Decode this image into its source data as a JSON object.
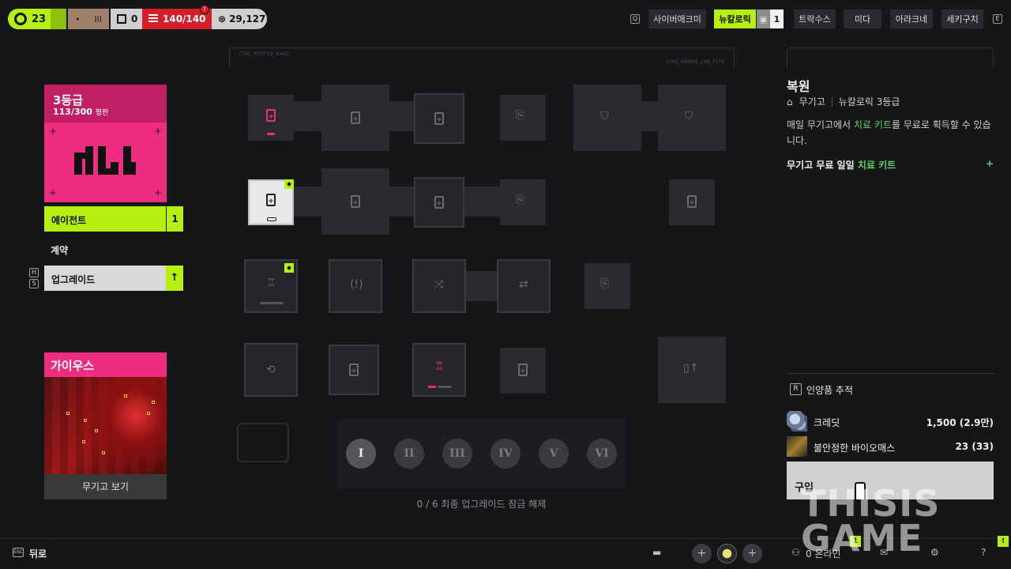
{
  "topbar": {
    "level": "23",
    "inventory_count": "0",
    "health": "140/140",
    "credits": "29,127",
    "brown_glyphs": [
      "•",
      "III"
    ],
    "key_left": "Q",
    "key_right": "E",
    "tabs": [
      {
        "label": "사이버애크미"
      },
      {
        "label": "뉴칼로릭"
      },
      {
        "label": "1"
      },
      {
        "label": "트락수스"
      },
      {
        "label": "미다"
      },
      {
        "label": "아라크네"
      },
      {
        "label": "세키구치"
      }
    ]
  },
  "left": {
    "grade_title": "3등급",
    "grade_progress": "113/300",
    "grade_rank": "평판",
    "logo_text": "NU",
    "agent_label": "에이전트",
    "agent_count": "1",
    "contract_label": "계약",
    "upgrade_label": "업그레이드",
    "upgrade_keys": [
      "H",
      "S"
    ],
    "virus_title": "가이우스",
    "virus_button": "무기고 보기"
  },
  "grid": {
    "frame_left_text": "CYAC_PROFILE_KALO",
    "frame_right_text": "CYAC_NAWEE_LAB_0178",
    "tiers": [
      "I",
      "II",
      "III",
      "IV",
      "V",
      "VI"
    ],
    "unlock_text": "0 / 6 최종 업그레이드 잠금 해제"
  },
  "right": {
    "title": "복원",
    "meta_source": "무기고",
    "meta_grade": "뉴칼로릭 3등급",
    "desc_pre": "매일 무기고에서 ",
    "desc_hl": "치료 키트",
    "desc_post": "를 무료로 획득할 수 있습니다.",
    "perk_pre": "무기고 무료 일일 ",
    "perk_hl": "치료 키트",
    "perk_plus": "+",
    "track_key": "R",
    "track_label": "인양품 추적",
    "resources": [
      {
        "name": "크레딧",
        "value": "1,500 (2.9만)"
      },
      {
        "name": "불안정한 바이오매스",
        "value": "23 (33)"
      }
    ],
    "buy_label": "구입"
  },
  "bottom": {
    "esc_key": "ESC",
    "back_label": "뒤로",
    "online_label": "0 온라인",
    "notif_a": "1",
    "notif_b": "!"
  },
  "watermark": [
    "THISIS",
    "GAME"
  ],
  "colors": {
    "accent_green": "#b6f010",
    "accent_pink": "#ee2d81",
    "health_red": "#d41e2a",
    "highlight_green": "#5ad06a"
  }
}
